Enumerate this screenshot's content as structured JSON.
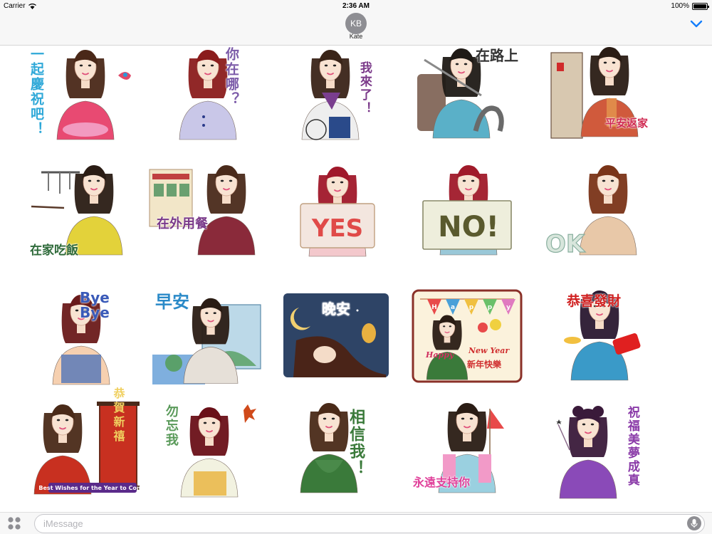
{
  "status_bar": {
    "carrier": "Carrier",
    "time": "2:36 AM",
    "battery": "100%"
  },
  "conversation": {
    "avatar_initials": "KB",
    "contact_name": "Kate"
  },
  "stickers": [
    {
      "caption": "一起慶祝吧！",
      "color": "#2ea8d8",
      "bg": "#e84a72",
      "hair": "#4a2818"
    },
    {
      "caption": "你在哪？",
      "color": "#7b5aa8",
      "bg": "#c9c7e8",
      "hair": "#8b1c1c"
    },
    {
      "caption": "我來了！",
      "color": "#7b3a8a",
      "bg": "#7a3e8e",
      "hair": "#3a2418"
    },
    {
      "caption": "在路上",
      "color": "#333333",
      "bg": "#5ab0c8",
      "hair": "#1f1a16"
    },
    {
      "caption": "平安返家",
      "color": "#d02a52",
      "bg": "#d05a3c",
      "hair": "#2a1c14"
    },
    {
      "caption": "在家吃飯",
      "color": "#2e6a3a",
      "bg": "#e3d23a",
      "hair": "#2a1c14"
    },
    {
      "caption": "在外用餐",
      "color": "#7a3a8a",
      "bg": "#8a2a3a",
      "hair": "#4a2a1a"
    },
    {
      "caption": "YES",
      "color": "#e04a48",
      "bg": "#f3e6df",
      "hair": "#a0182a"
    },
    {
      "caption": "NO!",
      "color": "#5a5a2e",
      "bg": "#eeeedc",
      "hair": "#a01a2a"
    },
    {
      "caption": "OK",
      "color": "#8ab0a0",
      "bg": "#e8c8a8",
      "hair": "#7a3418"
    },
    {
      "caption": "Bye Bye",
      "color": "#3a5ab8",
      "bg": "#5a7ab8",
      "hair": "#6a1a1a"
    },
    {
      "caption": "早安",
      "color": "#2a8ac8",
      "bg": "#5aa0d8",
      "hair": "#2a1c14"
    },
    {
      "caption": "晚安",
      "color": "#ffffff",
      "bg": "#2e4466",
      "hair": "#4a2418"
    },
    {
      "caption": "新年快樂",
      "color": "#d03030",
      "bg": "#fbf2dc",
      "hair": "#2a1c14"
    },
    {
      "caption": "恭喜發財",
      "color": "#d02020",
      "bg": "#3a9ac8",
      "hair": "#2a1830"
    },
    {
      "caption": "恭賀新禧",
      "color": "#f0d060",
      "bg": "#c83020",
      "hair": "#4a2a18"
    },
    {
      "caption": "勿忘我",
      "color": "#5a9a5a",
      "bg": "#e8b23a",
      "hair": "#6a1018"
    },
    {
      "caption": "相信我！",
      "color": "#3a7a3a",
      "bg": "#3a7a3a",
      "hair": "#4a2a18"
    },
    {
      "caption": "永遠支持你",
      "color": "#e0409a",
      "bg": "#f29ac8",
      "hair": "#2a1c14"
    },
    {
      "caption": "祝福美夢成真",
      "color": "#8a3aa8",
      "bg": "#8a4ab8",
      "hair": "#3a1a3a"
    }
  ],
  "sticker_extras": {
    "bye_line2": "Bye",
    "new_year_english": "New Year",
    "happy": "Happy",
    "banner_letters": [
      "H",
      "a",
      "p",
      "p",
      "y"
    ],
    "best_wishes": "Best Wishes for the Year to Come"
  },
  "input": {
    "placeholder": "iMessage"
  },
  "icons": {
    "apps": "apps-grid-icon",
    "mic": "microphone-icon",
    "chevron": "chevron-down-icon",
    "wifi": "wifi-icon"
  },
  "colors": {
    "accent": "#147efb",
    "bar": "#f7f7f7",
    "avatar": "#8e8e93"
  }
}
